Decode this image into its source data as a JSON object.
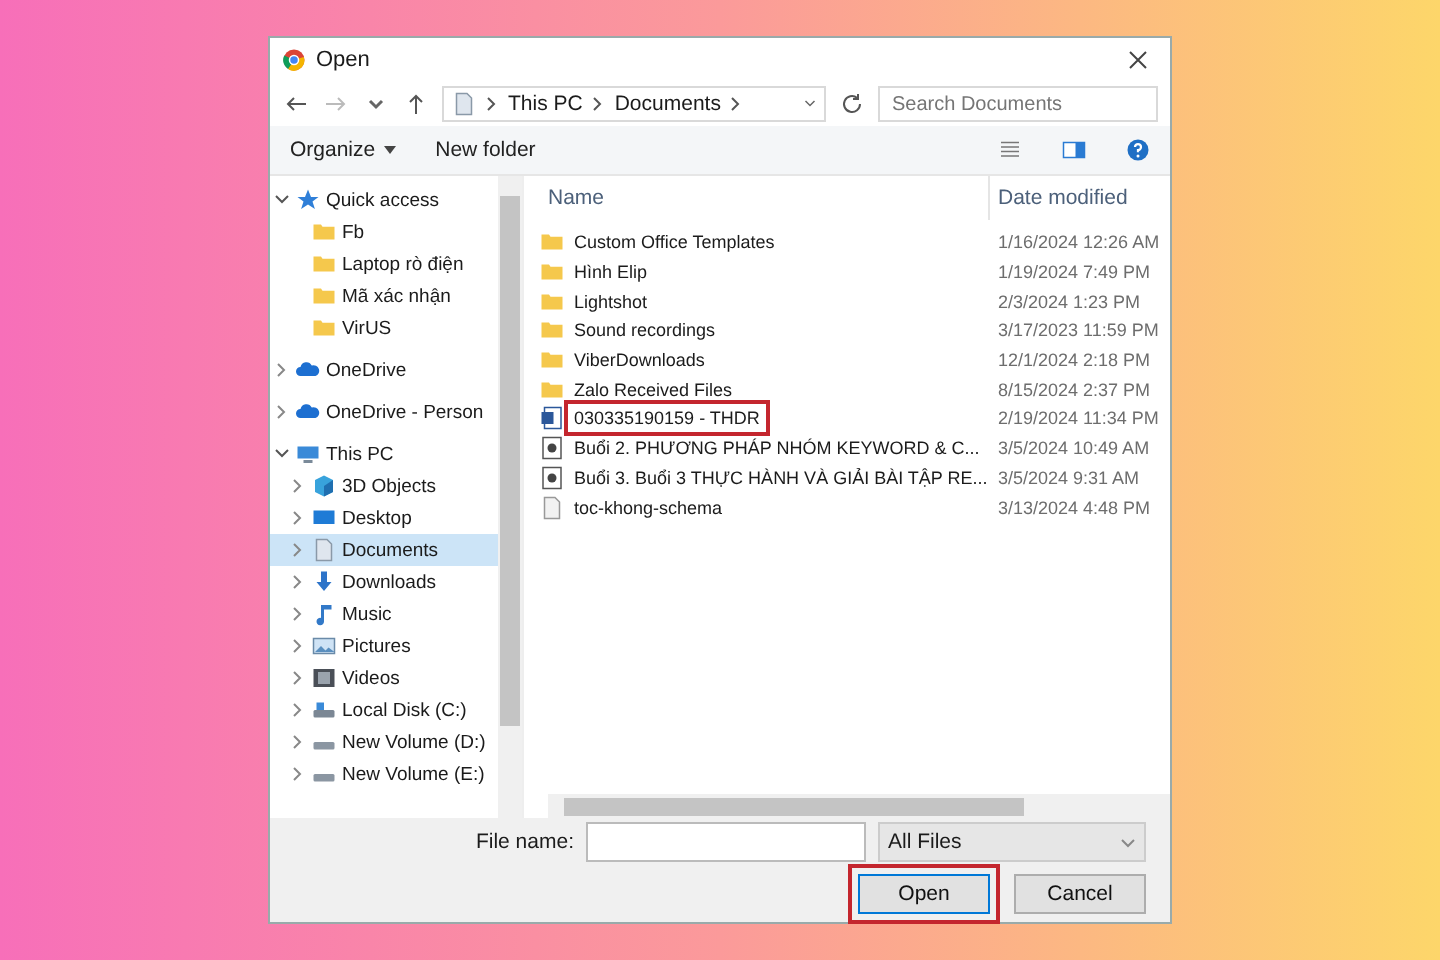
{
  "window": {
    "title": "Open"
  },
  "address": {
    "crumbs": [
      "This PC",
      "Documents"
    ]
  },
  "search": {
    "placeholder": "Search Documents"
  },
  "toolbar": {
    "organize": "Organize",
    "new_folder": "New folder"
  },
  "nav": [
    {
      "label": "Quick access",
      "kind": "star",
      "expanded": true,
      "selected": false,
      "children": [
        {
          "label": "Fb",
          "kind": "folder",
          "selected": false
        },
        {
          "label": "Laptop rò điện",
          "kind": "folder",
          "selected": false
        },
        {
          "label": "Mã xác nhận",
          "kind": "folder",
          "selected": false
        },
        {
          "label": "VirUS",
          "kind": "folder",
          "selected": false
        }
      ]
    },
    {
      "label": "OneDrive",
      "kind": "cloud",
      "expanded": false,
      "selected": false
    },
    {
      "label": "OneDrive - Person",
      "kind": "cloud",
      "expanded": false,
      "selected": false
    },
    {
      "label": "This PC",
      "kind": "pc",
      "expanded": true,
      "selected": false,
      "children": [
        {
          "label": "3D Objects",
          "kind": "cube",
          "expanded": false,
          "selected": false
        },
        {
          "label": "Desktop",
          "kind": "desktop",
          "expanded": false,
          "selected": false
        },
        {
          "label": "Documents",
          "kind": "documents",
          "expanded": false,
          "selected": true
        },
        {
          "label": "Downloads",
          "kind": "downloads",
          "expanded": false,
          "selected": false
        },
        {
          "label": "Music",
          "kind": "music",
          "expanded": false,
          "selected": false
        },
        {
          "label": "Pictures",
          "kind": "pictures",
          "expanded": false,
          "selected": false
        },
        {
          "label": "Videos",
          "kind": "videos",
          "expanded": false,
          "selected": false
        },
        {
          "label": "Local Disk (C:)",
          "kind": "disk",
          "expanded": false,
          "selected": false
        },
        {
          "label": "New Volume (D:)",
          "kind": "volume",
          "expanded": false,
          "selected": false
        },
        {
          "label": "New Volume (E:)",
          "kind": "volume",
          "expanded": false,
          "selected": false
        }
      ]
    }
  ],
  "table": {
    "columns": [
      "Name",
      "Date modified"
    ],
    "rows": [
      {
        "name": "Custom Office Templates",
        "date": "1/16/2024 12:26 AM",
        "kind": "folder",
        "highlighted": false
      },
      {
        "name": "Hình Elip",
        "date": "1/19/2024 7:49 PM",
        "kind": "folder",
        "highlighted": false
      },
      {
        "name": "Lightshot",
        "date": "2/3/2024 1:23 PM",
        "kind": "folder",
        "highlighted": false
      },
      {
        "name": "Sound recordings",
        "date": "3/17/2023 11:59 PM",
        "kind": "folder",
        "highlighted": false
      },
      {
        "name": "ViberDownloads",
        "date": "12/1/2024 2:18 PM",
        "kind": "folder",
        "highlighted": false
      },
      {
        "name": "Zalo Received Files",
        "date": "8/15/2024 2:37 PM",
        "kind": "folder",
        "highlighted": false
      },
      {
        "name": "030335190159 - THDR",
        "date": "2/19/2024 11:34 PM",
        "kind": "word",
        "highlighted": true
      },
      {
        "name": "Buổi 2. PHƯƠNG PHÁP NHÓM KEYWORD & C...",
        "date": "3/5/2024 10:49 AM",
        "kind": "doc",
        "highlighted": false
      },
      {
        "name": "Buổi 3. Buổi 3 THỰC HÀNH VÀ GIẢI BÀI TẬP RE...",
        "date": "3/5/2024 9:31 AM",
        "kind": "doc",
        "highlighted": false
      },
      {
        "name": "toc-khong-schema",
        "date": "3/13/2024 4:48 PM",
        "kind": "file",
        "highlighted": false
      }
    ]
  },
  "footer": {
    "file_name_label": "File name:",
    "filter": "All Files",
    "buttons": [
      {
        "label": "Open",
        "highlighted": true
      },
      {
        "label": "Cancel",
        "highlighted": false
      }
    ]
  }
}
